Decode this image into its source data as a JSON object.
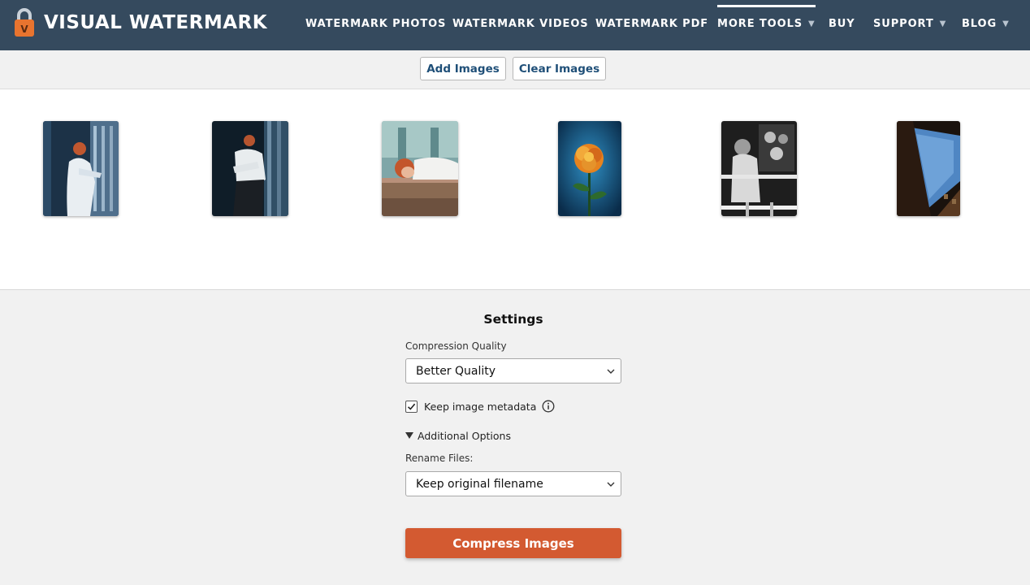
{
  "brand": {
    "name": "VISUAL WATERMARK",
    "icon": "lock-icon",
    "icon_letter": "V",
    "accent_color": "#d35a31",
    "header_color": "#354a5e"
  },
  "nav": {
    "items": [
      {
        "label": "WATERMARK PHOTOS",
        "dropdown": false,
        "active": false
      },
      {
        "label": "WATERMARK VIDEOS",
        "dropdown": false,
        "active": false
      },
      {
        "label": "WATERMARK PDF",
        "dropdown": false,
        "active": false
      },
      {
        "label": "MORE TOOLS",
        "dropdown": true,
        "active": true,
        "caret": "▼"
      },
      {
        "label": "BUY",
        "dropdown": false,
        "active": false
      },
      {
        "label": "SUPPORT",
        "dropdown": true,
        "active": false,
        "caret": "▼"
      },
      {
        "label": "BLOG",
        "dropdown": true,
        "active": false,
        "caret": "▼"
      }
    ]
  },
  "toolbar": {
    "add_label": "Add Images",
    "clear_label": "Clear Images"
  },
  "gallery": {
    "thumbnails": [
      {
        "subject": "woman-by-window"
      },
      {
        "subject": "woman-in-white-shirt"
      },
      {
        "subject": "woman-resting-on-table"
      },
      {
        "subject": "orange-flower"
      },
      {
        "subject": "monochrome-portrait"
      },
      {
        "subject": "sky-between-buildings"
      }
    ]
  },
  "settings": {
    "title": "Settings",
    "quality_label": "Compression Quality",
    "quality_value": "Better Quality",
    "metadata_label": "Keep image metadata",
    "metadata_checked": true,
    "additional_label": "Additional Options",
    "rename_label": "Rename Files:",
    "rename_value": "Keep original filename",
    "compress_label": "Compress Images"
  }
}
